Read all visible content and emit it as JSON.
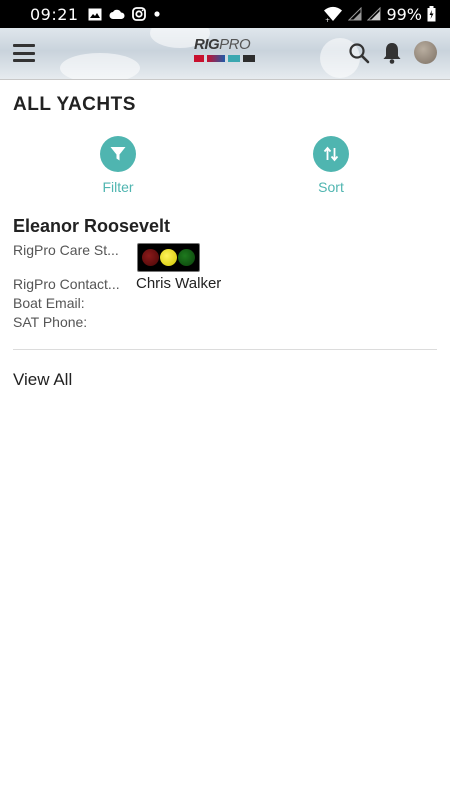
{
  "status_bar": {
    "time": "09:21",
    "left_icons": [
      "image-icon",
      "cloud-icon",
      "instagram-icon",
      "dot-icon"
    ],
    "battery": "99%"
  },
  "app_bar": {
    "logo_text_rig": "RIG",
    "logo_text_pro": "PRO"
  },
  "page": {
    "title": "ALL YACHTS"
  },
  "actions": {
    "filter_label": "Filter",
    "sort_label": "Sort"
  },
  "yacht": {
    "name": "Eleanor Roosevelt",
    "care_status_label": "RigPro Care St...",
    "contact_label": "RigPro Contact...",
    "contact_value": "Chris Walker",
    "email_label": "Boat Email:",
    "sat_label": "SAT Phone:",
    "care_status_light": "yellow"
  },
  "footer": {
    "view_all": "View All"
  },
  "colors": {
    "accent": "#4fb5b0",
    "status_red": "#8a1a1a",
    "status_yellow": "#fff35a",
    "status_green": "#1e7a1e"
  }
}
